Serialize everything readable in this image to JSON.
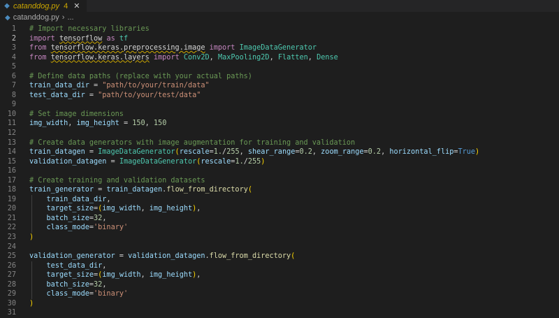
{
  "tab": {
    "filename": "catanddog.py",
    "problems": "4",
    "close": "✕"
  },
  "breadcrumb": {
    "file": "catanddog.py",
    "separator": "›",
    "symbol": "..."
  },
  "editor": {
    "active_line": 2,
    "lines": [
      [
        [
          "cm",
          "# Import necessary libraries"
        ]
      ],
      [
        [
          "kw",
          "import"
        ],
        [
          "p",
          " "
        ],
        [
          "sq",
          "tensorflow"
        ],
        [
          "p",
          " "
        ],
        [
          "kw",
          "as"
        ],
        [
          "p",
          " "
        ],
        [
          "cls",
          "tf"
        ]
      ],
      [
        [
          "kw",
          "from"
        ],
        [
          "p",
          " "
        ],
        [
          "sq",
          "tensorflow.keras.preprocessing.image"
        ],
        [
          "p",
          " "
        ],
        [
          "kw",
          "import"
        ],
        [
          "p",
          " "
        ],
        [
          "cls",
          "ImageDataGenerator"
        ]
      ],
      [
        [
          "kw",
          "from"
        ],
        [
          "p",
          " "
        ],
        [
          "sq",
          "tensorflow.keras.layers"
        ],
        [
          "p",
          " "
        ],
        [
          "kw",
          "import"
        ],
        [
          "p",
          " "
        ],
        [
          "cls",
          "Conv2D"
        ],
        [
          "p",
          ", "
        ],
        [
          "cls",
          "MaxPooling2D"
        ],
        [
          "p",
          ", "
        ],
        [
          "cls",
          "Flatten"
        ],
        [
          "p",
          ", "
        ],
        [
          "cls",
          "Dense"
        ]
      ],
      [],
      [
        [
          "cm",
          "# Define data paths (replace with your actual paths)"
        ]
      ],
      [
        [
          "var",
          "train_data_dir"
        ],
        [
          "p",
          " = "
        ],
        [
          "str",
          "\"path/to/your/train/data\""
        ]
      ],
      [
        [
          "var",
          "test_data_dir"
        ],
        [
          "p",
          " = "
        ],
        [
          "str",
          "\"path/to/your/test/data\""
        ]
      ],
      [],
      [
        [
          "cm",
          "# Set image dimensions"
        ]
      ],
      [
        [
          "var",
          "img_width"
        ],
        [
          "p",
          ", "
        ],
        [
          "var",
          "img_height"
        ],
        [
          "p",
          " = "
        ],
        [
          "num",
          "150"
        ],
        [
          "p",
          ", "
        ],
        [
          "num",
          "150"
        ]
      ],
      [],
      [
        [
          "cm",
          "# Create data generators with image augmentation for training and validation"
        ]
      ],
      [
        [
          "var",
          "train_datagen"
        ],
        [
          "p",
          " = "
        ],
        [
          "cls",
          "ImageDataGenerator"
        ],
        [
          "br",
          "("
        ],
        [
          "var",
          "rescale"
        ],
        [
          "p",
          "="
        ],
        [
          "num",
          "1."
        ],
        [
          "p",
          "/"
        ],
        [
          "num",
          "255"
        ],
        [
          "p",
          ", "
        ],
        [
          "var",
          "shear_range"
        ],
        [
          "p",
          "="
        ],
        [
          "num",
          "0.2"
        ],
        [
          "p",
          ", "
        ],
        [
          "var",
          "zoom_range"
        ],
        [
          "p",
          "="
        ],
        [
          "num",
          "0.2"
        ],
        [
          "p",
          ", "
        ],
        [
          "var",
          "horizontal_flip"
        ],
        [
          "p",
          "="
        ],
        [
          "const",
          "True"
        ],
        [
          "br",
          ")"
        ]
      ],
      [
        [
          "var",
          "validation_datagen"
        ],
        [
          "p",
          " = "
        ],
        [
          "cls",
          "ImageDataGenerator"
        ],
        [
          "br",
          "("
        ],
        [
          "var",
          "rescale"
        ],
        [
          "p",
          "="
        ],
        [
          "num",
          "1."
        ],
        [
          "p",
          "/"
        ],
        [
          "num",
          "255"
        ],
        [
          "br",
          ")"
        ]
      ],
      [],
      [
        [
          "cm",
          "# Create training and validation datasets"
        ]
      ],
      [
        [
          "var",
          "train_generator"
        ],
        [
          "p",
          " = "
        ],
        [
          "var",
          "train_datagen"
        ],
        [
          "p",
          "."
        ],
        [
          "fn",
          "flow_from_directory"
        ],
        [
          "br",
          "("
        ]
      ],
      [
        [
          "p",
          "    "
        ],
        [
          "var",
          "train_data_dir"
        ],
        [
          "p",
          ","
        ]
      ],
      [
        [
          "p",
          "    "
        ],
        [
          "var",
          "target_size"
        ],
        [
          "p",
          "="
        ],
        [
          "br",
          "("
        ],
        [
          "var",
          "img_width"
        ],
        [
          "p",
          ", "
        ],
        [
          "var",
          "img_height"
        ],
        [
          "br",
          ")"
        ],
        [
          "p",
          ","
        ]
      ],
      [
        [
          "p",
          "    "
        ],
        [
          "var",
          "batch_size"
        ],
        [
          "p",
          "="
        ],
        [
          "num",
          "32"
        ],
        [
          "p",
          ","
        ]
      ],
      [
        [
          "p",
          "    "
        ],
        [
          "var",
          "class_mode"
        ],
        [
          "p",
          "="
        ],
        [
          "str",
          "'binary'"
        ]
      ],
      [
        [
          "br",
          ")"
        ]
      ],
      [],
      [
        [
          "var",
          "validation_generator"
        ],
        [
          "p",
          " = "
        ],
        [
          "var",
          "validation_datagen"
        ],
        [
          "p",
          "."
        ],
        [
          "fn",
          "flow_from_directory"
        ],
        [
          "br",
          "("
        ]
      ],
      [
        [
          "p",
          "    "
        ],
        [
          "var",
          "test_data_dir"
        ],
        [
          "p",
          ","
        ]
      ],
      [
        [
          "p",
          "    "
        ],
        [
          "var",
          "target_size"
        ],
        [
          "p",
          "="
        ],
        [
          "br",
          "("
        ],
        [
          "var",
          "img_width"
        ],
        [
          "p",
          ", "
        ],
        [
          "var",
          "img_height"
        ],
        [
          "br",
          ")"
        ],
        [
          "p",
          ","
        ]
      ],
      [
        [
          "p",
          "    "
        ],
        [
          "var",
          "batch_size"
        ],
        [
          "p",
          "="
        ],
        [
          "num",
          "32"
        ],
        [
          "p",
          ","
        ]
      ],
      [
        [
          "p",
          "    "
        ],
        [
          "var",
          "class_mode"
        ],
        [
          "p",
          "="
        ],
        [
          "str",
          "'binary'"
        ]
      ],
      [
        [
          "br",
          ")"
        ]
      ],
      []
    ]
  }
}
